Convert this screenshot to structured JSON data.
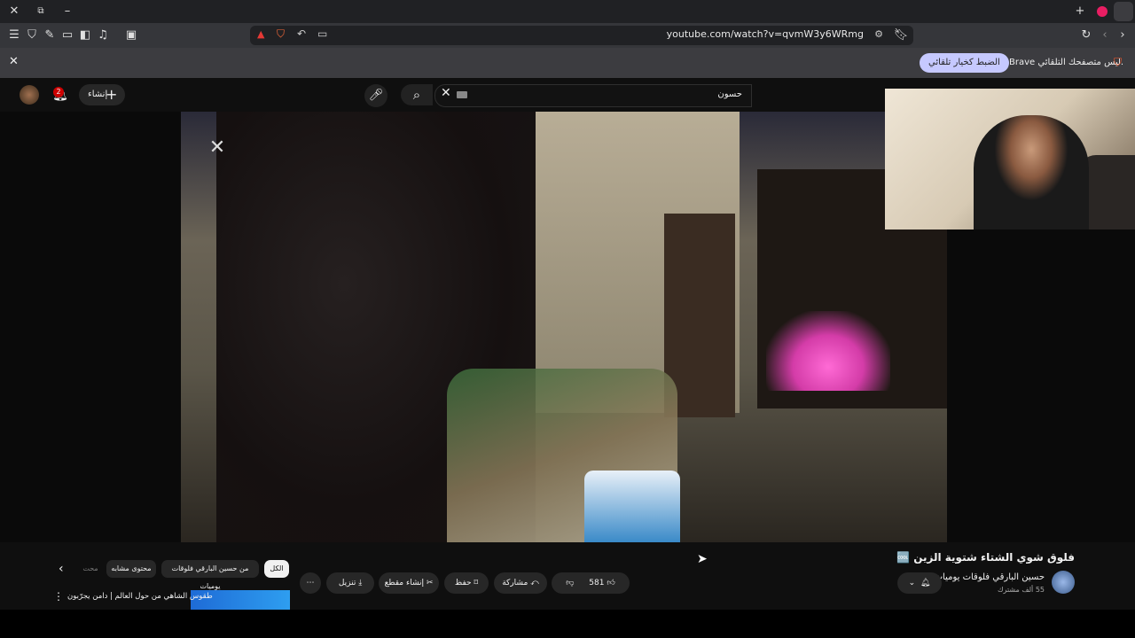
{
  "browser": {
    "url": "youtube.com/watch?v=qvmW3y6WRmg",
    "infobar_text": "Brave ليس متصفحك التلقائي.",
    "infobar_button": "الضبط كخيار تلقائي"
  },
  "youtube": {
    "create_label": "إنشاء",
    "notifications_count": "2",
    "search_value": "حسون",
    "video_title": "فلوق شوي الشتاء شتوية الزين 🆒",
    "channel_name": "حسين البارقي فلوقات يوميات",
    "subscribers": "55 ألف مشترك",
    "like_count": "581",
    "share_label": "مشاركة",
    "save_label": "حفظ",
    "clip_label": "إنشاء مقطع",
    "download_label": "تنزيل",
    "chips": [
      "الكل",
      "من حسين البارقي فلوقات يوميات",
      "محتوى مشابه",
      "محت"
    ],
    "rec_title": "طقوس الشاهي من حول العالم | دامن يجرّبون"
  }
}
